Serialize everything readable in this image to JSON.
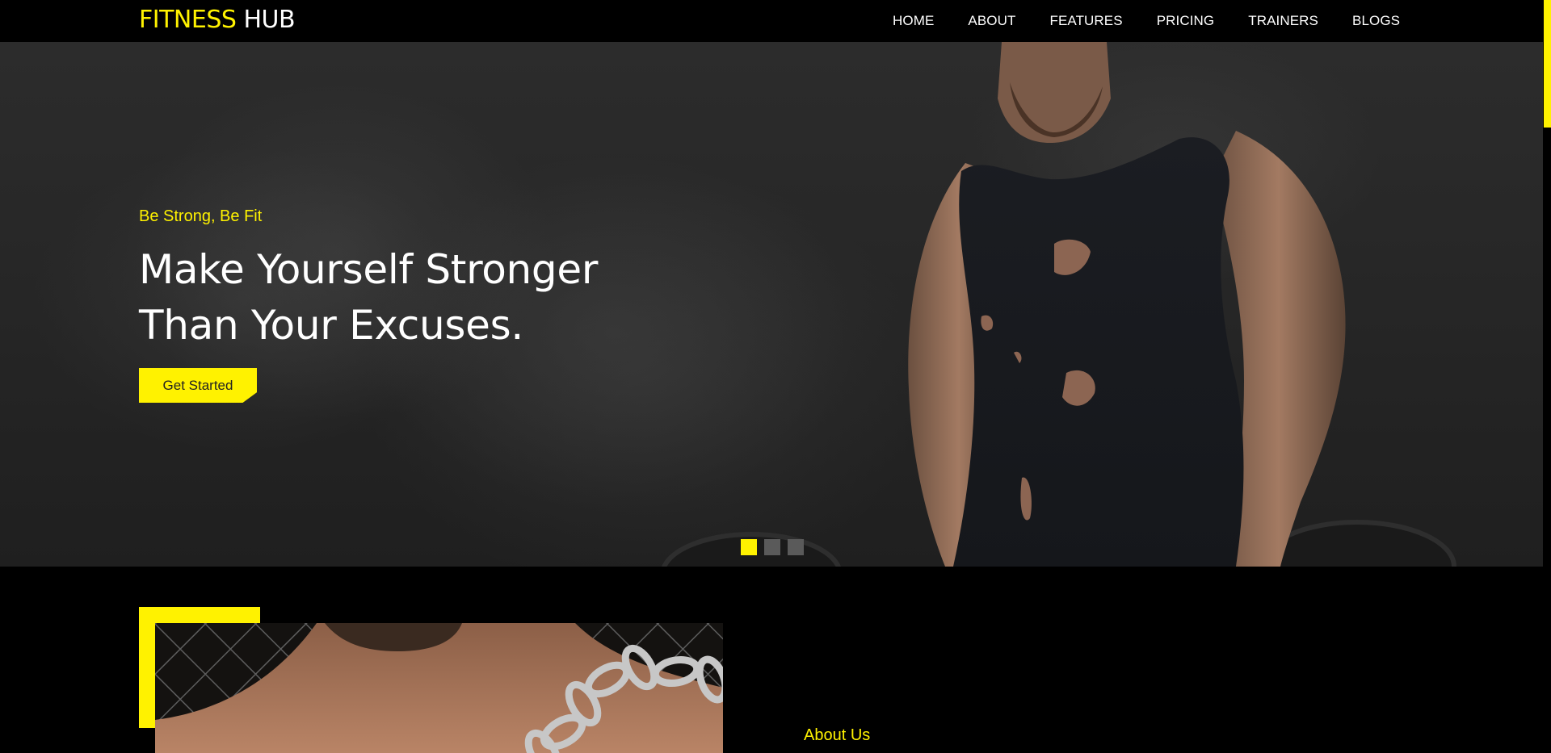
{
  "brand": {
    "part1": "FITNESS",
    "part2": "HUB"
  },
  "nav": {
    "items": [
      "HOME",
      "ABOUT",
      "FEATURES",
      "PRICING",
      "TRAINERS",
      "BLOGS"
    ]
  },
  "hero": {
    "tagline": "Be Strong, Be Fit",
    "headline_line1": "Make Yourself Stronger",
    "headline_line2": "Than Your Excuses.",
    "cta_label": "Get Started",
    "slides_count": 3,
    "active_slide": 1
  },
  "about": {
    "label": "About Us"
  },
  "colors": {
    "accent": "#fff200",
    "background": "#000000",
    "hero_bg": "#262626"
  }
}
